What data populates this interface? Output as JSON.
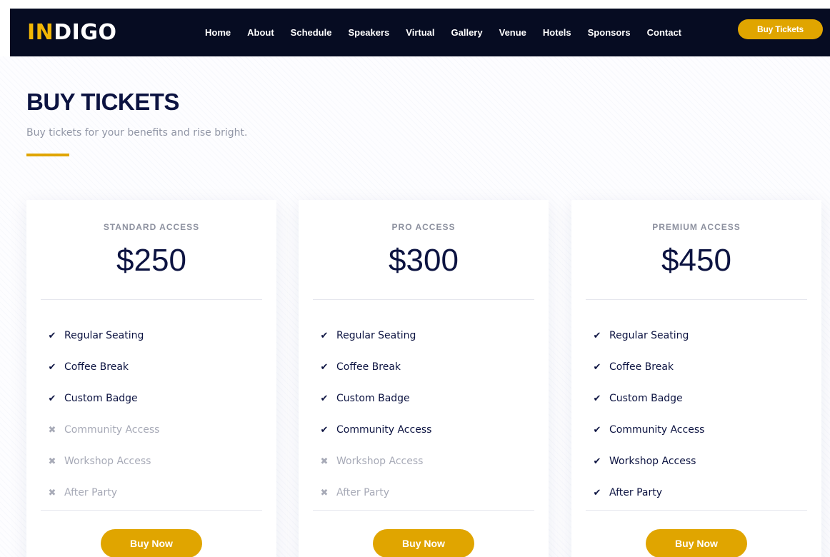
{
  "brand": {
    "accent_text": "IN",
    "rest_text": "DIGO",
    "accent_color": "#f2b705"
  },
  "nav": {
    "links": [
      "Home",
      "About",
      "Schedule",
      "Speakers",
      "Virtual",
      "Gallery",
      "Venue",
      "Hotels",
      "Sponsors",
      "Contact"
    ],
    "cta": "Buy Tickets"
  },
  "section": {
    "title": "BUY TICKETS",
    "subtitle": "Buy tickets for your benefits and rise bright."
  },
  "plans": [
    {
      "name": "STANDARD ACCESS",
      "price": "$250",
      "button": "Buy Now",
      "features": [
        {
          "label": "Regular Seating",
          "included": true
        },
        {
          "label": "Coffee Break",
          "included": true
        },
        {
          "label": "Custom Badge",
          "included": true
        },
        {
          "label": "Community Access",
          "included": false
        },
        {
          "label": "Workshop Access",
          "included": false
        },
        {
          "label": "After Party",
          "included": false
        }
      ]
    },
    {
      "name": "PRO ACCESS",
      "price": "$300",
      "button": "Buy Now",
      "features": [
        {
          "label": "Regular Seating",
          "included": true
        },
        {
          "label": "Coffee Break",
          "included": true
        },
        {
          "label": "Custom Badge",
          "included": true
        },
        {
          "label": "Community Access",
          "included": true
        },
        {
          "label": "Workshop Access",
          "included": false
        },
        {
          "label": "After Party",
          "included": false
        }
      ]
    },
    {
      "name": "PREMIUM ACCESS",
      "price": "$450",
      "button": "Buy Now",
      "features": [
        {
          "label": "Regular Seating",
          "included": true
        },
        {
          "label": "Coffee Break",
          "included": true
        },
        {
          "label": "Custom Badge",
          "included": true
        },
        {
          "label": "Community Access",
          "included": true
        },
        {
          "label": "Workshop Access",
          "included": true
        },
        {
          "label": "After Party",
          "included": true
        }
      ]
    }
  ],
  "icons": {
    "included": "check-icon",
    "excluded": "x-icon"
  },
  "colors": {
    "navy": "#0c1341",
    "gold": "#e0a500",
    "muted": "#a7aab7",
    "nav_bg": "#060c22"
  }
}
